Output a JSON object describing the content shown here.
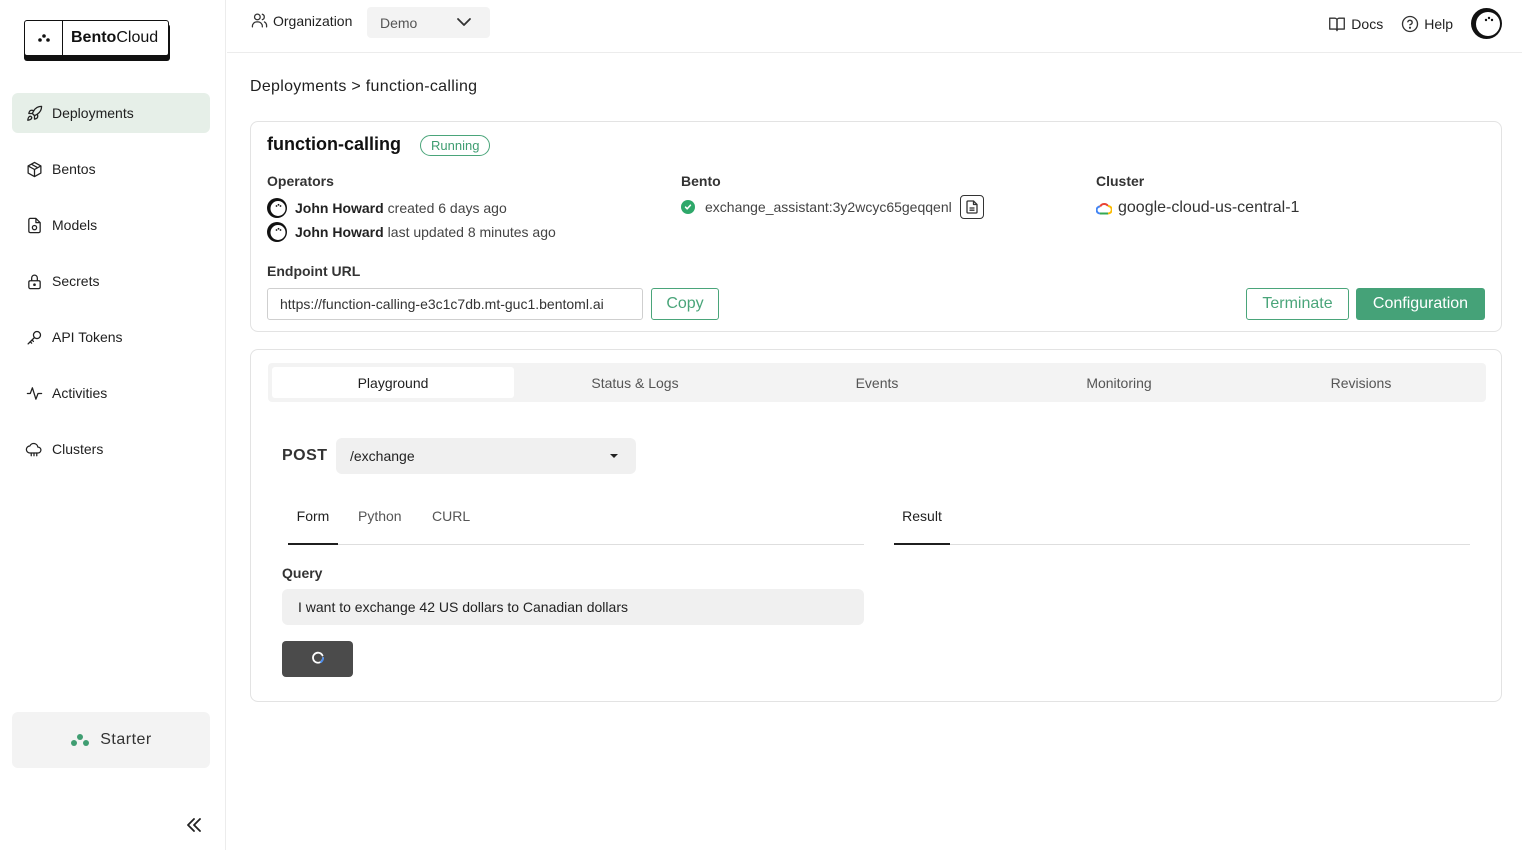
{
  "brand": {
    "name_bold": "Bento",
    "name_regular": "Cloud"
  },
  "sidebar": {
    "items": [
      {
        "label": "Deployments",
        "icon": "rocket-icon",
        "active": true
      },
      {
        "label": "Bentos",
        "icon": "box-icon"
      },
      {
        "label": "Models",
        "icon": "model-file-icon"
      },
      {
        "label": "Secrets",
        "icon": "lock-icon"
      },
      {
        "label": "API Tokens",
        "icon": "key-icon"
      },
      {
        "label": "Activities",
        "icon": "activity-icon"
      },
      {
        "label": "Clusters",
        "icon": "cloud-icon"
      }
    ],
    "plan_label": "Starter"
  },
  "topbar": {
    "org_label": "Organization",
    "org_value": "Demo",
    "docs_label": "Docs",
    "help_label": "Help"
  },
  "breadcrumb": "Deployments > function-calling",
  "deployment": {
    "name": "function-calling",
    "status": "Running",
    "operators_label": "Operators",
    "operators": [
      {
        "user": "John Howard",
        "action": "created 6 days ago"
      },
      {
        "user": "John Howard",
        "action": "last updated 8 minutes ago"
      }
    ],
    "bento_label": "Bento",
    "bento_value": "exchange_assistant:3y2wcyc65geqqenl",
    "cluster_label": "Cluster",
    "cluster_value": "google-cloud-us-central-1",
    "endpoint_label": "Endpoint URL",
    "endpoint_url": "https://function-calling-e3c1c7db.mt-guc1.bentoml.ai",
    "copy_label": "Copy",
    "terminate_label": "Terminate",
    "configuration_label": "Configuration"
  },
  "tabs": [
    "Playground",
    "Status & Logs",
    "Events",
    "Monitoring",
    "Revisions"
  ],
  "playground": {
    "method": "POST",
    "route": "/exchange",
    "input_tabs": [
      "Form",
      "Python",
      "CURL"
    ],
    "result_tab": "Result",
    "query_label": "Query",
    "query_value": "I want to exchange 42 US dollars to Canadian dollars"
  },
  "colors": {
    "accent": "#45a278",
    "active_nav_bg": "#e6efe8",
    "running_badge": "#3f9d71",
    "submit_button": "#4b4b4b"
  }
}
